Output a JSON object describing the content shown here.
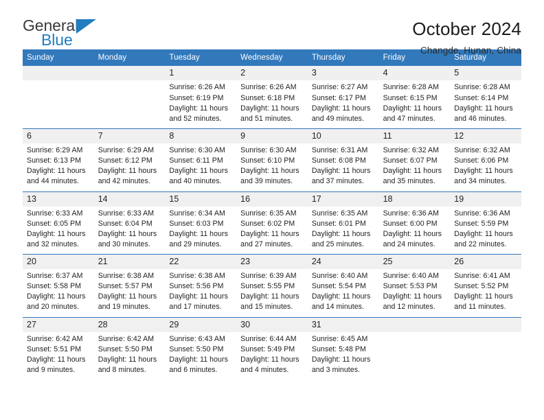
{
  "brand": {
    "name_part1": "General",
    "name_part2": "Blue",
    "logo_icon": "triangle-logo-icon",
    "accent_color": "#1f7dc0"
  },
  "header": {
    "title": "October 2024",
    "subtitle": "Changde, Hunan, China"
  },
  "theme": {
    "header_blue": "#3279bc",
    "daynum_band": "#f0f0f0",
    "text": "#1e1e1e"
  },
  "calendar": {
    "weekday_headers": [
      "Sunday",
      "Monday",
      "Tuesday",
      "Wednesday",
      "Thursday",
      "Friday",
      "Saturday"
    ],
    "weeks": [
      {
        "days": [
          {
            "num": "",
            "empty": true,
            "sunrise": "",
            "sunset": "",
            "daylight_l1": "",
            "daylight_l2": ""
          },
          {
            "num": "",
            "empty": true,
            "sunrise": "",
            "sunset": "",
            "daylight_l1": "",
            "daylight_l2": ""
          },
          {
            "num": "1",
            "empty": false,
            "sunrise": "Sunrise: 6:26 AM",
            "sunset": "Sunset: 6:19 PM",
            "daylight_l1": "Daylight: 11 hours",
            "daylight_l2": "and 52 minutes."
          },
          {
            "num": "2",
            "empty": false,
            "sunrise": "Sunrise: 6:26 AM",
            "sunset": "Sunset: 6:18 PM",
            "daylight_l1": "Daylight: 11 hours",
            "daylight_l2": "and 51 minutes."
          },
          {
            "num": "3",
            "empty": false,
            "sunrise": "Sunrise: 6:27 AM",
            "sunset": "Sunset: 6:17 PM",
            "daylight_l1": "Daylight: 11 hours",
            "daylight_l2": "and 49 minutes."
          },
          {
            "num": "4",
            "empty": false,
            "sunrise": "Sunrise: 6:28 AM",
            "sunset": "Sunset: 6:15 PM",
            "daylight_l1": "Daylight: 11 hours",
            "daylight_l2": "and 47 minutes."
          },
          {
            "num": "5",
            "empty": false,
            "sunrise": "Sunrise: 6:28 AM",
            "sunset": "Sunset: 6:14 PM",
            "daylight_l1": "Daylight: 11 hours",
            "daylight_l2": "and 46 minutes."
          }
        ]
      },
      {
        "days": [
          {
            "num": "6",
            "empty": false,
            "sunrise": "Sunrise: 6:29 AM",
            "sunset": "Sunset: 6:13 PM",
            "daylight_l1": "Daylight: 11 hours",
            "daylight_l2": "and 44 minutes."
          },
          {
            "num": "7",
            "empty": false,
            "sunrise": "Sunrise: 6:29 AM",
            "sunset": "Sunset: 6:12 PM",
            "daylight_l1": "Daylight: 11 hours",
            "daylight_l2": "and 42 minutes."
          },
          {
            "num": "8",
            "empty": false,
            "sunrise": "Sunrise: 6:30 AM",
            "sunset": "Sunset: 6:11 PM",
            "daylight_l1": "Daylight: 11 hours",
            "daylight_l2": "and 40 minutes."
          },
          {
            "num": "9",
            "empty": false,
            "sunrise": "Sunrise: 6:30 AM",
            "sunset": "Sunset: 6:10 PM",
            "daylight_l1": "Daylight: 11 hours",
            "daylight_l2": "and 39 minutes."
          },
          {
            "num": "10",
            "empty": false,
            "sunrise": "Sunrise: 6:31 AM",
            "sunset": "Sunset: 6:08 PM",
            "daylight_l1": "Daylight: 11 hours",
            "daylight_l2": "and 37 minutes."
          },
          {
            "num": "11",
            "empty": false,
            "sunrise": "Sunrise: 6:32 AM",
            "sunset": "Sunset: 6:07 PM",
            "daylight_l1": "Daylight: 11 hours",
            "daylight_l2": "and 35 minutes."
          },
          {
            "num": "12",
            "empty": false,
            "sunrise": "Sunrise: 6:32 AM",
            "sunset": "Sunset: 6:06 PM",
            "daylight_l1": "Daylight: 11 hours",
            "daylight_l2": "and 34 minutes."
          }
        ]
      },
      {
        "days": [
          {
            "num": "13",
            "empty": false,
            "sunrise": "Sunrise: 6:33 AM",
            "sunset": "Sunset: 6:05 PM",
            "daylight_l1": "Daylight: 11 hours",
            "daylight_l2": "and 32 minutes."
          },
          {
            "num": "14",
            "empty": false,
            "sunrise": "Sunrise: 6:33 AM",
            "sunset": "Sunset: 6:04 PM",
            "daylight_l1": "Daylight: 11 hours",
            "daylight_l2": "and 30 minutes."
          },
          {
            "num": "15",
            "empty": false,
            "sunrise": "Sunrise: 6:34 AM",
            "sunset": "Sunset: 6:03 PM",
            "daylight_l1": "Daylight: 11 hours",
            "daylight_l2": "and 29 minutes."
          },
          {
            "num": "16",
            "empty": false,
            "sunrise": "Sunrise: 6:35 AM",
            "sunset": "Sunset: 6:02 PM",
            "daylight_l1": "Daylight: 11 hours",
            "daylight_l2": "and 27 minutes."
          },
          {
            "num": "17",
            "empty": false,
            "sunrise": "Sunrise: 6:35 AM",
            "sunset": "Sunset: 6:01 PM",
            "daylight_l1": "Daylight: 11 hours",
            "daylight_l2": "and 25 minutes."
          },
          {
            "num": "18",
            "empty": false,
            "sunrise": "Sunrise: 6:36 AM",
            "sunset": "Sunset: 6:00 PM",
            "daylight_l1": "Daylight: 11 hours",
            "daylight_l2": "and 24 minutes."
          },
          {
            "num": "19",
            "empty": false,
            "sunrise": "Sunrise: 6:36 AM",
            "sunset": "Sunset: 5:59 PM",
            "daylight_l1": "Daylight: 11 hours",
            "daylight_l2": "and 22 minutes."
          }
        ]
      },
      {
        "days": [
          {
            "num": "20",
            "empty": false,
            "sunrise": "Sunrise: 6:37 AM",
            "sunset": "Sunset: 5:58 PM",
            "daylight_l1": "Daylight: 11 hours",
            "daylight_l2": "and 20 minutes."
          },
          {
            "num": "21",
            "empty": false,
            "sunrise": "Sunrise: 6:38 AM",
            "sunset": "Sunset: 5:57 PM",
            "daylight_l1": "Daylight: 11 hours",
            "daylight_l2": "and 19 minutes."
          },
          {
            "num": "22",
            "empty": false,
            "sunrise": "Sunrise: 6:38 AM",
            "sunset": "Sunset: 5:56 PM",
            "daylight_l1": "Daylight: 11 hours",
            "daylight_l2": "and 17 minutes."
          },
          {
            "num": "23",
            "empty": false,
            "sunrise": "Sunrise: 6:39 AM",
            "sunset": "Sunset: 5:55 PM",
            "daylight_l1": "Daylight: 11 hours",
            "daylight_l2": "and 15 minutes."
          },
          {
            "num": "24",
            "empty": false,
            "sunrise": "Sunrise: 6:40 AM",
            "sunset": "Sunset: 5:54 PM",
            "daylight_l1": "Daylight: 11 hours",
            "daylight_l2": "and 14 minutes."
          },
          {
            "num": "25",
            "empty": false,
            "sunrise": "Sunrise: 6:40 AM",
            "sunset": "Sunset: 5:53 PM",
            "daylight_l1": "Daylight: 11 hours",
            "daylight_l2": "and 12 minutes."
          },
          {
            "num": "26",
            "empty": false,
            "sunrise": "Sunrise: 6:41 AM",
            "sunset": "Sunset: 5:52 PM",
            "daylight_l1": "Daylight: 11 hours",
            "daylight_l2": "and 11 minutes."
          }
        ]
      },
      {
        "days": [
          {
            "num": "27",
            "empty": false,
            "sunrise": "Sunrise: 6:42 AM",
            "sunset": "Sunset: 5:51 PM",
            "daylight_l1": "Daylight: 11 hours",
            "daylight_l2": "and 9 minutes."
          },
          {
            "num": "28",
            "empty": false,
            "sunrise": "Sunrise: 6:42 AM",
            "sunset": "Sunset: 5:50 PM",
            "daylight_l1": "Daylight: 11 hours",
            "daylight_l2": "and 8 minutes."
          },
          {
            "num": "29",
            "empty": false,
            "sunrise": "Sunrise: 6:43 AM",
            "sunset": "Sunset: 5:50 PM",
            "daylight_l1": "Daylight: 11 hours",
            "daylight_l2": "and 6 minutes."
          },
          {
            "num": "30",
            "empty": false,
            "sunrise": "Sunrise: 6:44 AM",
            "sunset": "Sunset: 5:49 PM",
            "daylight_l1": "Daylight: 11 hours",
            "daylight_l2": "and 4 minutes."
          },
          {
            "num": "31",
            "empty": false,
            "sunrise": "Sunrise: 6:45 AM",
            "sunset": "Sunset: 5:48 PM",
            "daylight_l1": "Daylight: 11 hours",
            "daylight_l2": "and 3 minutes."
          },
          {
            "num": "",
            "empty": true,
            "sunrise": "",
            "sunset": "",
            "daylight_l1": "",
            "daylight_l2": ""
          },
          {
            "num": "",
            "empty": true,
            "sunrise": "",
            "sunset": "",
            "daylight_l1": "",
            "daylight_l2": ""
          }
        ]
      }
    ]
  }
}
